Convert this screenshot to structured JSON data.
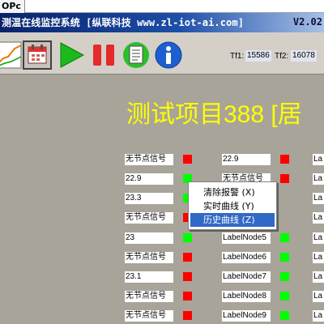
{
  "tab": {
    "label": "OPc"
  },
  "titlebar": {
    "title": "测温在线监控系统 [纵联科技 www.zl-iot-ai.com]",
    "version": "V2.02"
  },
  "toolbar": {
    "buttons": [
      {
        "icon": "curve-chart-icon"
      },
      {
        "icon": "calendar-icon"
      },
      {
        "icon": "play-icon"
      },
      {
        "icon": "pause-icon"
      },
      {
        "icon": "document-icon"
      },
      {
        "icon": "info-icon"
      }
    ],
    "tf1_label": "Tf1:",
    "tf1_value": "15586",
    "tf2_label": "Tf2:",
    "tf2_value": "16078"
  },
  "main": {
    "project_title": "测试项目388 [居"
  },
  "colors": {
    "alarm": "#ff0000",
    "normal": "#00ff00",
    "title_text": "#ffff00",
    "background": "#a8a499"
  },
  "nodes": {
    "col1": [
      {
        "label": "无节点信号",
        "status": "red"
      },
      {
        "label": "22.9",
        "status": "green"
      },
      {
        "label": "23.3",
        "status": "green"
      },
      {
        "label": "无节点信号",
        "status": "red"
      },
      {
        "label": "23",
        "status": "green"
      },
      {
        "label": "无节点信号",
        "status": "red"
      },
      {
        "label": "23.1",
        "status": "red"
      },
      {
        "label": "无节点信号",
        "status": "red"
      },
      {
        "label": "无节点信号",
        "status": "red"
      }
    ],
    "col2": [
      {
        "label": "22.9",
        "status": "red"
      },
      {
        "label": "无节点信号",
        "status": "red"
      },
      {
        "label": "",
        "status": ""
      },
      {
        "label": "",
        "status": ""
      },
      {
        "label": "LabelNode5",
        "status": "green"
      },
      {
        "label": "LabelNode6",
        "status": "green"
      },
      {
        "label": "LabelNode7",
        "status": "green"
      },
      {
        "label": "LabelNode8",
        "status": "green"
      },
      {
        "label": "LabelNode9",
        "status": "green"
      }
    ],
    "col3": [
      {
        "label": "La"
      },
      {
        "label": "La"
      },
      {
        "label": "La"
      },
      {
        "label": "La"
      },
      {
        "label": "La"
      },
      {
        "label": "La"
      },
      {
        "label": "La"
      },
      {
        "label": "La"
      },
      {
        "label": "La"
      }
    ]
  },
  "context_menu": {
    "items": [
      {
        "label": "清除报警 (X)"
      },
      {
        "label": "实时曲线 (Y)"
      },
      {
        "label": "历史曲线 (Z)"
      }
    ],
    "selected_index": 2
  }
}
